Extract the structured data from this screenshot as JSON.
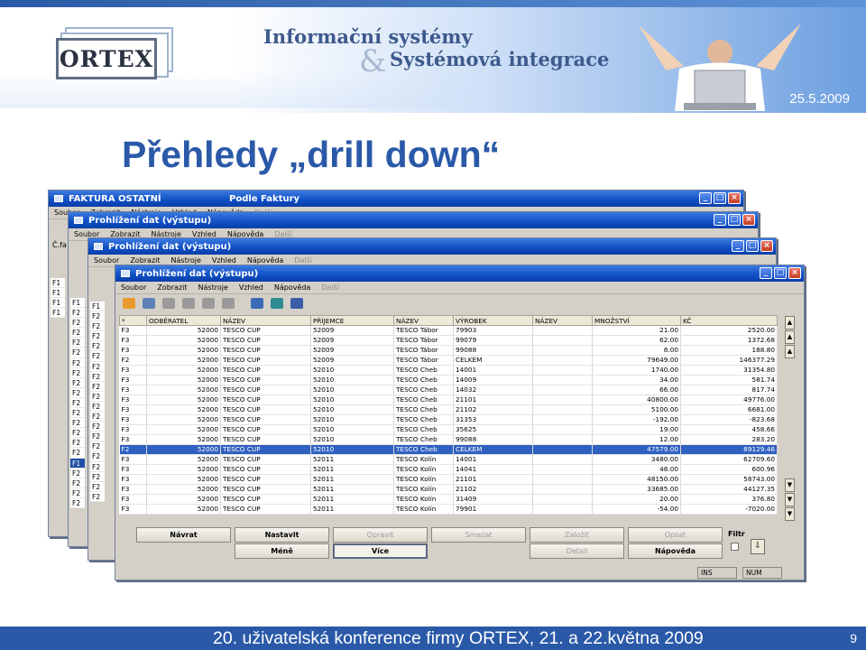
{
  "header": {
    "logo": "ORTEX",
    "tagline_line1": "Informační systémy",
    "tagline_amp": "&",
    "tagline_line2": "Systémová integrace",
    "date": "25.5.2009"
  },
  "slide_title": "Přehledy „drill down“",
  "windows": [
    {
      "title": "FAKTURA OSTATNÍ",
      "title_right": "Podle Faktury",
      "menu": [
        "Soubor",
        "Zobrazit",
        "Nástroje",
        "Vzhled",
        "Nápověda",
        "Další"
      ]
    },
    {
      "title": "Prohlížení dat (výstupu)",
      "menu": [
        "Soubor",
        "Zobrazit",
        "Nástroje",
        "Vzhled",
        "Nápověda",
        "Další"
      ]
    },
    {
      "title": "Prohlížení dat (výstupu)",
      "menu": [
        "Soubor",
        "Zobrazit",
        "Nástroje",
        "Vzhled",
        "Nápověda",
        "Další"
      ]
    },
    {
      "title": "Prohlížení dat (výstupu)",
      "menu": [
        "Soubor",
        "Zobrazit",
        "Nástroje",
        "Vzhled",
        "Nápověda",
        "Další"
      ]
    }
  ],
  "back_codes": {
    "w1_label": "Č.fa",
    "w1": [
      "F1",
      "F1",
      "F1",
      "F1"
    ],
    "w2": [
      "F1",
      "F2",
      "F2",
      "F2",
      "F2",
      "F2",
      "F2",
      "F2",
      "F2",
      "F2",
      "F2",
      "F2",
      "F2",
      "F2",
      "F2",
      "F2",
      "F1",
      "F2",
      "F2",
      "F2",
      "F2"
    ],
    "w3": [
      "F1",
      "F2",
      "F2",
      "F2",
      "F2",
      "F2",
      "F2",
      "F2",
      "F2",
      "F2",
      "F2",
      "F2",
      "F2",
      "F2",
      "F2",
      "F2",
      "F2",
      "F2",
      "F2",
      "F2"
    ]
  },
  "grid": {
    "columns": [
      "*",
      "ODBĚRATEL",
      "NÁZEV",
      "PŘÍJEMCE",
      "NÁZEV",
      "VÝROBEK",
      "NÁZEV",
      "MNOŽSTVÍ",
      "KČ"
    ],
    "selected_row": 12,
    "rows": [
      [
        "F3",
        "52000",
        "TESCO CUP",
        "52009",
        "TESCO Tábor",
        "79903",
        "",
        "21.00",
        "2520.00"
      ],
      [
        "F3",
        "52000",
        "TESCO CUP",
        "52009",
        "TESCO Tábor",
        "99079",
        "",
        "62.00",
        "1372.68"
      ],
      [
        "F3",
        "52000",
        "TESCO CUP",
        "52009",
        "TESCO Tábor",
        "99088",
        "",
        "8.00",
        "188.80"
      ],
      [
        "F2",
        "52000",
        "TESCO CUP",
        "52009",
        "TESCO Tábor",
        "CELKEM",
        "",
        "79649.00",
        "146377.29"
      ],
      [
        "F3",
        "52000",
        "TESCO CUP",
        "52010",
        "TESCO Cheb",
        "14001",
        "",
        "1740.00",
        "31354.80"
      ],
      [
        "F3",
        "52000",
        "TESCO CUP",
        "52010",
        "TESCO Cheb",
        "14009",
        "",
        "34.00",
        "581.74"
      ],
      [
        "F3",
        "52000",
        "TESCO CUP",
        "52010",
        "TESCO Cheb",
        "14032",
        "",
        "66.00",
        "817.74"
      ],
      [
        "F3",
        "52000",
        "TESCO CUP",
        "52010",
        "TESCO Cheb",
        "21101",
        "",
        "40800.00",
        "49776.00"
      ],
      [
        "F3",
        "52000",
        "TESCO CUP",
        "52010",
        "TESCO Cheb",
        "21102",
        "",
        "5100.00",
        "6681.00"
      ],
      [
        "F3",
        "52000",
        "TESCO CUP",
        "52010",
        "TESCO Cheb",
        "31353",
        "",
        "-192.00",
        "-823.68"
      ],
      [
        "F3",
        "52000",
        "TESCO CUP",
        "52010",
        "TESCO Cheb",
        "35625",
        "",
        "19.00",
        "458.66"
      ],
      [
        "F3",
        "52000",
        "TESCO CUP",
        "52010",
        "TESCO Cheb",
        "99088",
        "",
        "12.00",
        "283.20"
      ],
      [
        "F2",
        "52000",
        "TESCO CUP",
        "52010",
        "TESCO Cheb",
        "CELKEM",
        "",
        "47579.00",
        "89129.46"
      ],
      [
        "F3",
        "52000",
        "TESCO CUP",
        "52011",
        "TESCO Kolín",
        "14001",
        "",
        "3480.00",
        "62709.60"
      ],
      [
        "F3",
        "52000",
        "TESCO CUP",
        "52011",
        "TESCO Kolín",
        "14041",
        "",
        "48.00",
        "600.96"
      ],
      [
        "F3",
        "52000",
        "TESCO CUP",
        "52011",
        "TESCO Kolín",
        "21101",
        "",
        "48150.00",
        "58743.00"
      ],
      [
        "F3",
        "52000",
        "TESCO CUP",
        "52011",
        "TESCO Kolín",
        "21102",
        "",
        "33685.00",
        "44127.35"
      ],
      [
        "F3",
        "52000",
        "TESCO CUP",
        "52011",
        "TESCO Kolín",
        "31409",
        "",
        "20.00",
        "376.80"
      ],
      [
        "F3",
        "52000",
        "TESCO CUP",
        "52011",
        "TESCO Kolín",
        "79901",
        "",
        "-54.00",
        "-7020.00"
      ]
    ]
  },
  "buttons": {
    "navrat": "Návrat",
    "nastavit": "Nastavit",
    "opravit": "Opravit",
    "smazat": "Smazat",
    "zalozit": "Založit",
    "opsat": "Opsat",
    "mene": "Méně",
    "vice": "Více",
    "detail": "Detail",
    "napoveda": "Nápověda",
    "filtr": "Filtr"
  },
  "status": {
    "ins": "INS",
    "num": "NUM"
  },
  "footer": {
    "text": "20. uživatelská konference firmy ORTEX, 21. a 22.května 2009",
    "page": "9"
  }
}
